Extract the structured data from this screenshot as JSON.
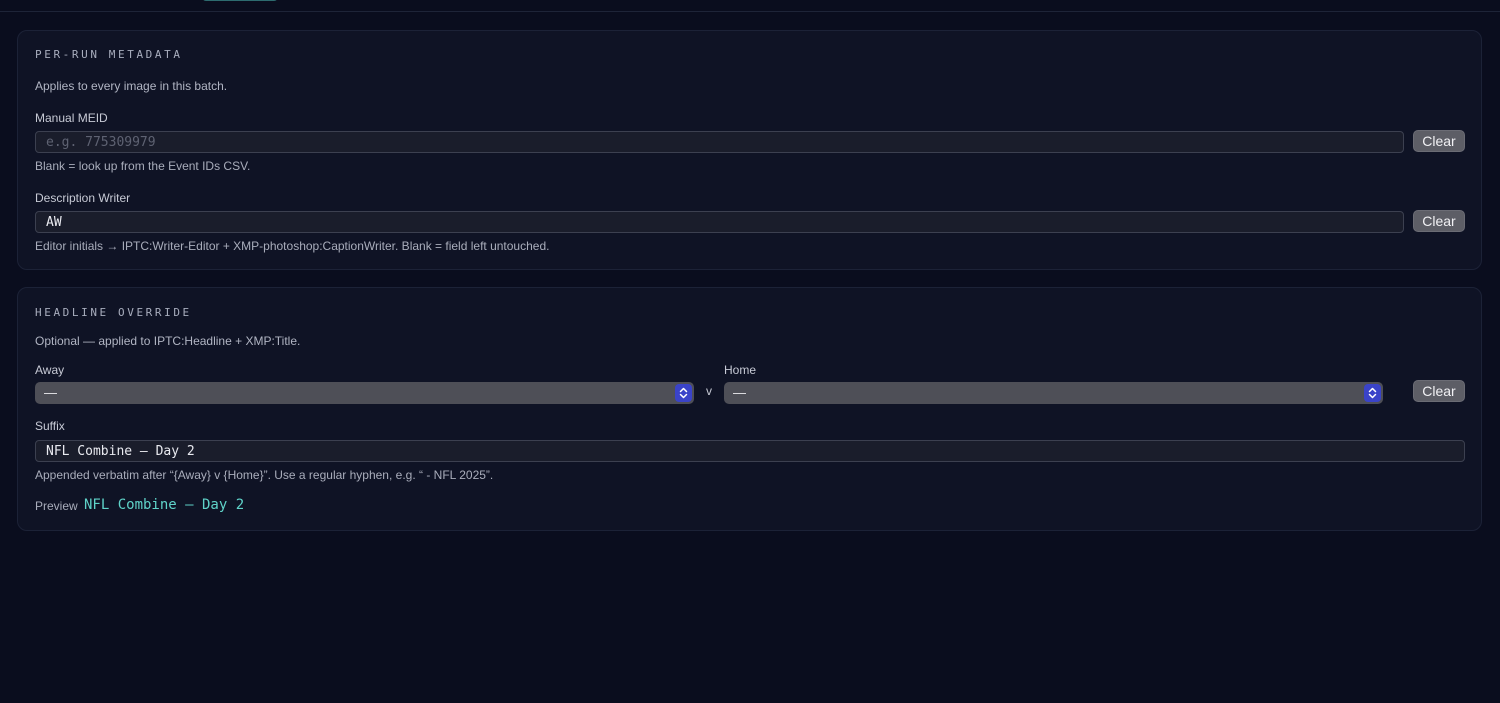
{
  "per_run": {
    "title": "PER-RUN METADATA",
    "description": "Applies to every image in this batch.",
    "meid": {
      "label": "Manual MEID",
      "placeholder": "e.g. 775309979",
      "value": "",
      "hint": "Blank = look up from the Event IDs CSV.",
      "clear_label": "Clear"
    },
    "writer": {
      "label": "Description Writer",
      "value": "AW",
      "hint": "Editor initials → IPTC:Writer-Editor + XMP-photoshop:CaptionWriter. Blank = field left untouched.",
      "clear_label": "Clear"
    }
  },
  "headline": {
    "title": "HEADLINE OVERRIDE",
    "description": "Optional — applied to IPTC:Headline + XMP:Title.",
    "away": {
      "label": "Away",
      "value": "—"
    },
    "separator": "v",
    "home": {
      "label": "Home",
      "value": "—"
    },
    "clear_label": "Clear",
    "suffix": {
      "label": "Suffix",
      "value": "NFL Combine – Day 2",
      "hint": "Appended verbatim after “{Away} v {Home}”. Use a regular hyphen, e.g. “ - NFL 2025”."
    },
    "preview": {
      "label": "Preview",
      "value": "NFL Combine – Day 2"
    }
  },
  "colors": {
    "background": "#0a0d1e",
    "card": "#0f1325",
    "accent": "#5fd3c9",
    "select_arrow": "#3a43c9",
    "button": "#5d5e66"
  },
  "icons": {
    "select_arrows": "chevron-up-down-icon"
  }
}
